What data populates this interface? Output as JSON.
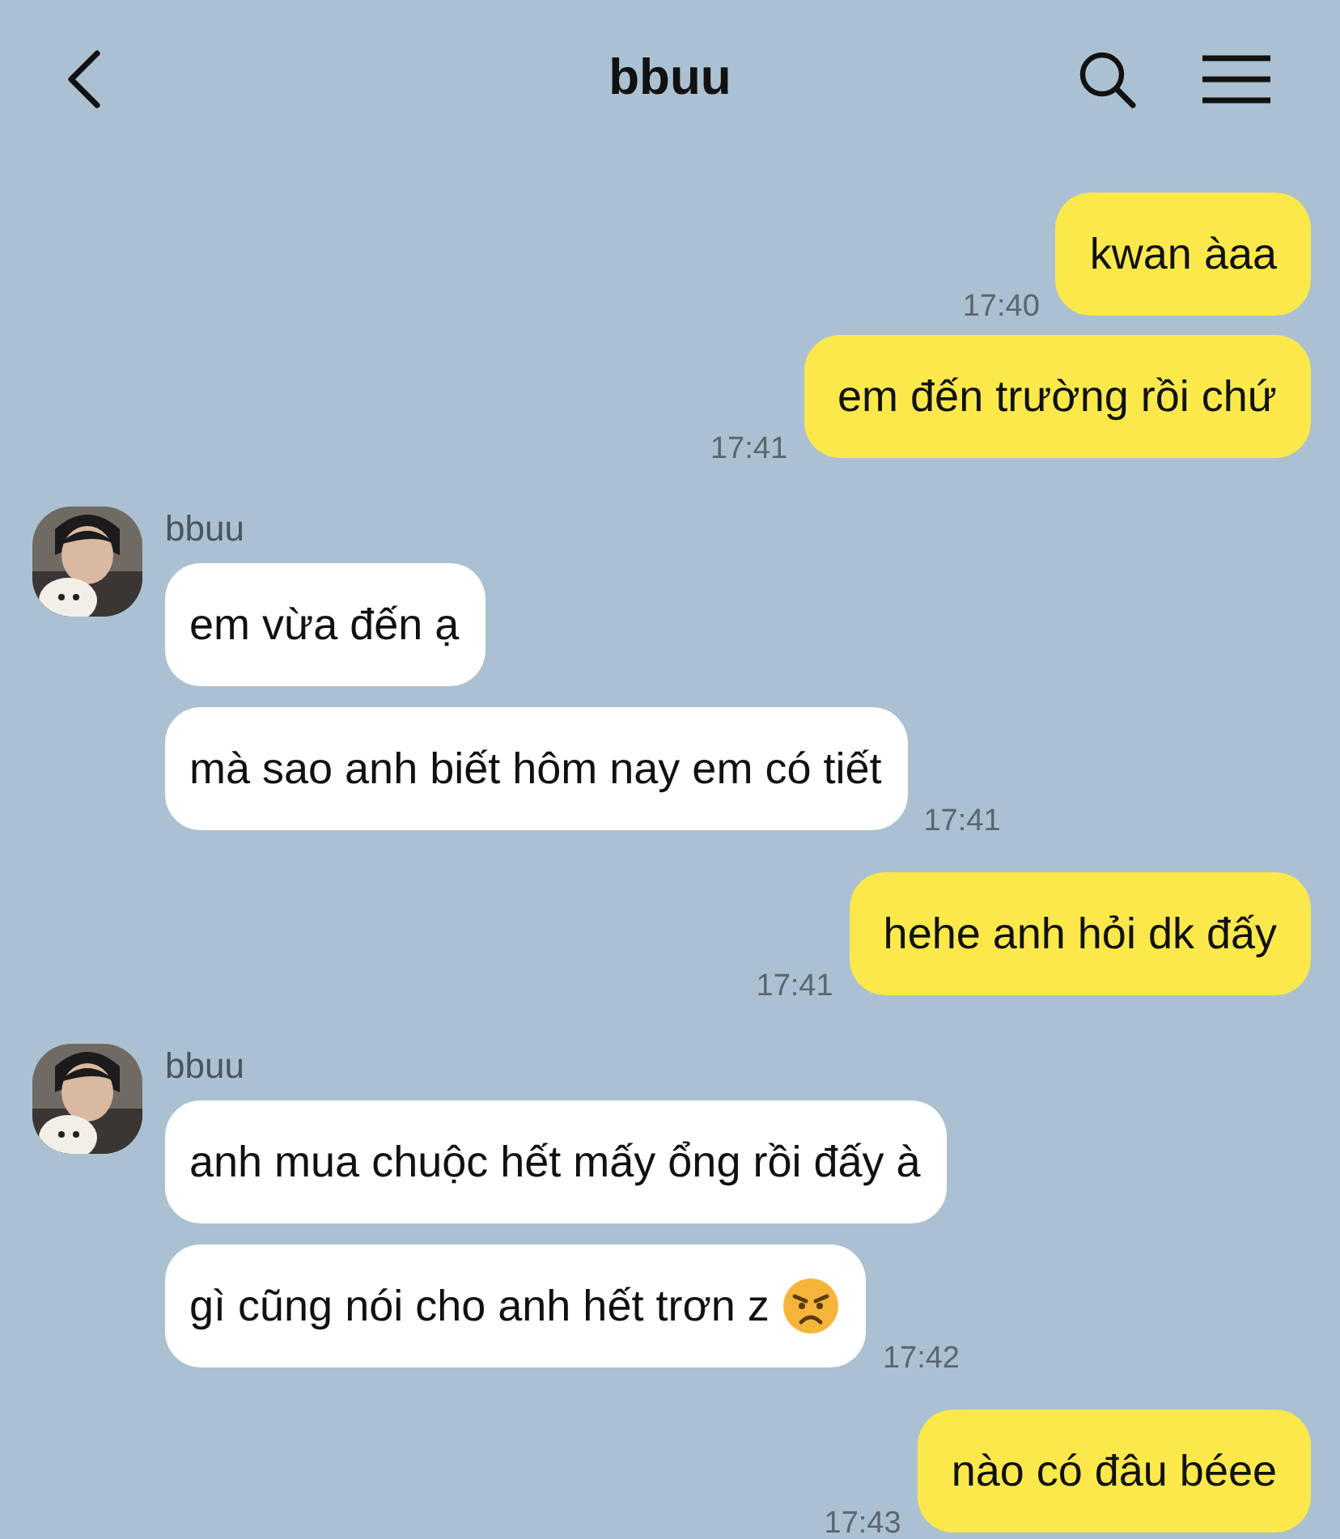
{
  "header": {
    "title": "bbuu"
  },
  "groups": [
    {
      "kind": "out",
      "messages": [
        {
          "text": "kwan àaa",
          "time": "17:40"
        },
        {
          "text": "em đến trường rồi chứ",
          "time": "17:41"
        }
      ]
    },
    {
      "kind": "in",
      "name": "bbuu",
      "messages": [
        {
          "kind": "plain",
          "text": "em vừa đến ạ"
        },
        {
          "kind": "plain",
          "text": "mà sao anh biết hôm nay em có tiết",
          "time": "17:41"
        }
      ]
    },
    {
      "kind": "out",
      "messages": [
        {
          "text": "hehe anh hỏi dk đấy",
          "time": "17:41"
        }
      ]
    },
    {
      "kind": "in",
      "name": "bbuu",
      "messages": [
        {
          "kind": "plain",
          "text": "anh mua chuộc hết mấy ổng rồi đấy à"
        },
        {
          "kind": "emoji",
          "text": "gì cũng nói cho anh hết trơn z",
          "time": "17:42"
        }
      ]
    },
    {
      "kind": "out",
      "messages": [
        {
          "text": "nào có đâu béee",
          "time": "17:43"
        }
      ]
    }
  ]
}
